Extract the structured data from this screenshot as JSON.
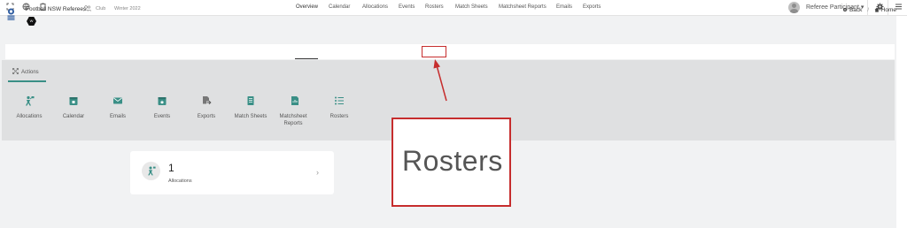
{
  "topbar": {
    "icons": [
      "expand-icon",
      "globe-icon",
      "clipboard-icon"
    ],
    "user_name": "Referee Participant ▾",
    "settings_icon": "gear-icon",
    "menu_icon": "menu-icon"
  },
  "header": {
    "org_name": "Football NSW Referees",
    "group_icon": "people-icon",
    "club_label": "Club",
    "season_label": "Winter 2022",
    "badge_text": "W",
    "back_label": "Back",
    "home_label": "Home"
  },
  "tabs": [
    {
      "label": "Overview",
      "active": true
    },
    {
      "label": "Calendar",
      "active": false
    },
    {
      "label": "Allocations",
      "active": false
    },
    {
      "label": "Events",
      "active": false
    },
    {
      "label": "Rosters",
      "active": false
    },
    {
      "label": "Match Sheets",
      "active": false
    },
    {
      "label": "Matchsheet Reports",
      "active": false
    },
    {
      "label": "Emails",
      "active": false
    },
    {
      "label": "Exports",
      "active": false
    }
  ],
  "actions": {
    "tab_label": "Actions",
    "items": [
      {
        "label": "Allocations",
        "icon": "referee-icon"
      },
      {
        "label": "Calendar",
        "icon": "calendar-icon"
      },
      {
        "label": "Emails",
        "icon": "email-icon"
      },
      {
        "label": "Events",
        "icon": "event-icon"
      },
      {
        "label": "Exports",
        "icon": "export-icon"
      },
      {
        "label": "Match Sheets",
        "icon": "match-sheet-icon"
      },
      {
        "label": "Matchsheet Reports",
        "icon": "report-icon"
      },
      {
        "label": "Rosters",
        "icon": "list-icon"
      }
    ]
  },
  "stat_card": {
    "count": "1",
    "label": "Allocations",
    "chevron": "›"
  },
  "callout": {
    "text": "Rosters"
  },
  "colors": {
    "accent": "#3a8f86",
    "highlight": "#c62d2d"
  }
}
